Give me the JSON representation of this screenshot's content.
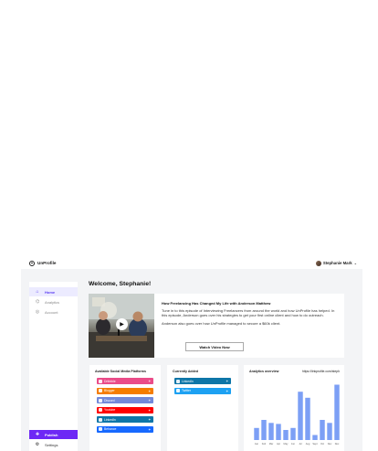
{
  "brand": {
    "name": "UnProfile"
  },
  "user": {
    "name": "Stephanie Mark"
  },
  "sidebar": {
    "items": [
      {
        "label": "Home",
        "icon": "home-icon",
        "glyph": "⌂",
        "active": true
      },
      {
        "label": "Analytics",
        "icon": "analytics-icon",
        "glyph": "⌬",
        "active": false
      },
      {
        "label": "Account",
        "icon": "account-icon",
        "glyph": "◎",
        "active": false
      }
    ],
    "bottom": [
      {
        "label": "Publish",
        "icon": "publish-icon",
        "glyph": "✚"
      },
      {
        "label": "Settings",
        "icon": "gear-icon",
        "glyph": "⚙"
      }
    ]
  },
  "welcome": "Welcome, Stephanie!",
  "feature": {
    "title": "How Freelancing Has Changed My Life with Anderson Matthew",
    "description": "Tune in to this episode of Interviewing Freelancers from around the world and how UnProfile has helped. In this episode, Anderson goes over his strategies to get your first online client and how to do outreach.",
    "description2": "Anderson also goes over how UnProfile managed to secure a $60k client.",
    "button": "Watch Video Now"
  },
  "platforms": {
    "title": "Available Social Media Platforms",
    "items": [
      {
        "name": "Dribbble",
        "color": "#ea4c89"
      },
      {
        "name": "Blogger",
        "color": "#f57d00"
      },
      {
        "name": "Discord",
        "color": "#7289da"
      },
      {
        "name": "Youtube",
        "color": "#ff0000"
      },
      {
        "name": "LinkedIn",
        "color": "#0e76a8"
      },
      {
        "name": "Behance",
        "color": "#1769ff"
      }
    ]
  },
  "added": {
    "title": "Currently Added",
    "items": [
      {
        "name": "LinkedIn",
        "color": "#0e76a8"
      },
      {
        "name": "Twitter",
        "color": "#1da1f2"
      }
    ]
  },
  "overview": {
    "title": "Analytics overview",
    "url": "https://linkprofile.com/steph"
  },
  "chart_data": {
    "type": "bar",
    "categories": [
      "Jan",
      "Feb",
      "Mar",
      "Apr",
      "May",
      "Jun",
      "Jul",
      "Aug",
      "Sept",
      "Oct",
      "Nov",
      "Dec"
    ],
    "values": [
      12,
      20,
      17,
      16,
      10,
      12,
      48,
      42,
      5,
      20,
      17,
      55
    ],
    "ylim": [
      0,
      60
    ],
    "grid": false,
    "bar_color": "#7c9ff5"
  }
}
